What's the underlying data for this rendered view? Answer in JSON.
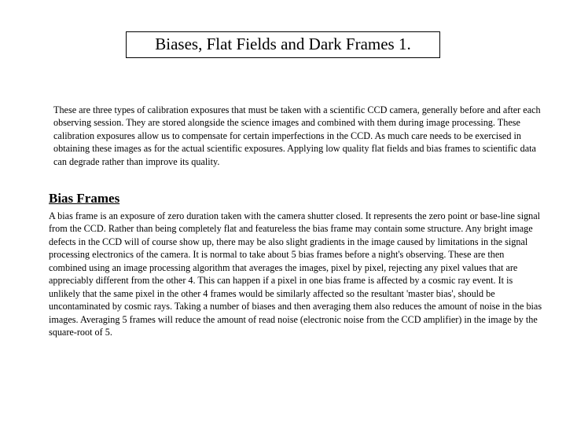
{
  "title": "Biases, Flat Fields and Dark Frames 1.",
  "intro": "These are three types of calibration exposures that must be taken with a scientific  CCD camera, generally before and after each observing session. They are stored alongside the science images and combined with them during  image processing. These calibration exposures allow us to compensate for certain imperfections in the CCD. As much care needs to be exercised in obtaining these images as for the actual scientific exposures. Applying low quality flat fields and bias frames to scientific data can degrade rather than improve its quality.",
  "section": {
    "heading": "Bias Frames",
    "body": "A bias frame is an exposure of zero duration taken with the camera shutter closed. It represents the zero point or base-line signal from the CCD. Rather than being completely flat and featureless the bias frame  may contain some structure. Any bright image defects in the CCD will of course show up, there may be also slight gradients in the image caused by limitations in the signal processing electronics of the camera. It is normal to take about 5 bias frames before a night's observing. These are then combined using an image processing algorithm that averages the images, pixel by pixel, rejecting any pixel values that are appreciably different from the other 4. This can happen if a pixel in one bias frame  is affected by a cosmic ray event. It is unlikely that the same pixel in the other 4 frames would be similarly affected so the resultant 'master bias', should be uncontaminated by cosmic rays. Taking  a number of biases and then averaging them also reduces the amount of noise in the bias images. Averaging 5 frames will reduce the amount of read noise (electronic noise from the CCD amplifier) in the image by the square-root of 5."
  }
}
